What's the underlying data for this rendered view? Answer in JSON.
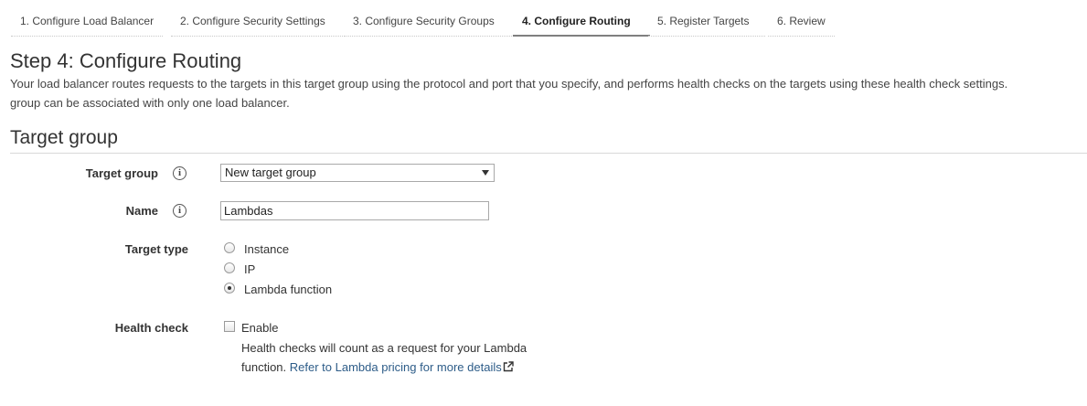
{
  "wizard": {
    "tabs": [
      {
        "label": "1. Configure Load Balancer",
        "active": false
      },
      {
        "label": "2. Configure Security Settings",
        "active": false
      },
      {
        "label": "3. Configure Security Groups",
        "active": false
      },
      {
        "label": "4. Configure Routing",
        "active": true
      },
      {
        "label": "5. Register Targets",
        "active": false
      },
      {
        "label": "6. Review",
        "active": false
      }
    ]
  },
  "page": {
    "title": "Step 4: Configure Routing",
    "intro_line1": "Your load balancer routes requests to the targets in this target group using the protocol and port that you specify, and performs health checks on the targets using these health check settings.",
    "intro_line2": "group can be associated with only one load balancer."
  },
  "target_group_section": {
    "title": "Target group",
    "target_group": {
      "label": "Target group",
      "selected": "New target group",
      "info_icon": "info-icon"
    },
    "name": {
      "label": "Name",
      "value": "Lambdas",
      "info_icon": "info-icon"
    },
    "target_type": {
      "label": "Target type",
      "options": [
        {
          "label": "Instance",
          "checked": false
        },
        {
          "label": "IP",
          "checked": false
        },
        {
          "label": "Lambda function",
          "checked": true
        }
      ]
    },
    "health_check": {
      "label": "Health check",
      "checkbox_label": "Enable",
      "checked": false,
      "help_text": "Health checks will count as a request for your Lambda function.",
      "help_link": "Refer to Lambda pricing for more details",
      "link_icon": "external-link-icon"
    }
  },
  "colors": {
    "link": "#2d5c88",
    "active_tab_border": "#7f7f7f"
  }
}
